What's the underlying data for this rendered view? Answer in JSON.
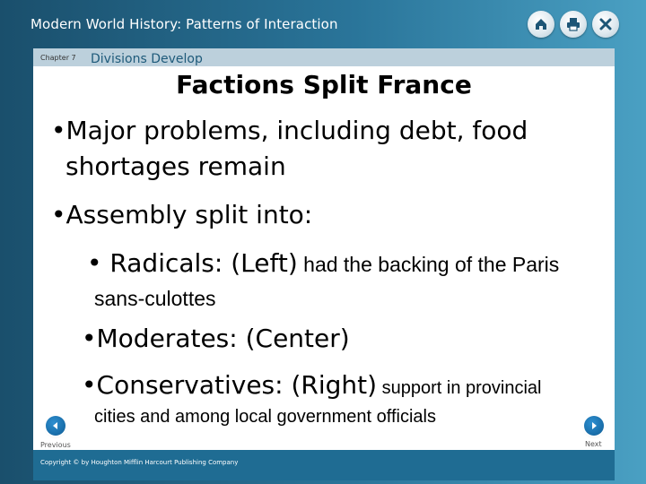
{
  "header": {
    "app_title": "Modern World History: Patterns of Interaction"
  },
  "top_icons": [
    "home-icon",
    "print-icon",
    "close-icon"
  ],
  "chapter": {
    "label": "Chapter 7",
    "title": "Divisions Develop"
  },
  "slide": {
    "heading": "Factions Split France",
    "bullets": [
      {
        "marker": "•",
        "text_line1": "Major problems, including debt, food",
        "text_line2": "shortages remain"
      },
      {
        "marker": "•",
        "text": "Assembly split into:"
      },
      {
        "marker": "•",
        "label": "Radicals: (Left)",
        "detail": " had the backing of the Paris",
        "detail_line2": "sans-culottes"
      },
      {
        "marker": "•",
        "label": "Moderates: (Center)"
      },
      {
        "marker": "•",
        "label": "Conservatives: (Right)",
        "detail": " support in provincial",
        "detail_line2": "cities and among local government officials"
      }
    ]
  },
  "nav": {
    "previous_label": "Previous",
    "next_label": "Next"
  },
  "footer": {
    "copyright": "Copyright © by Houghton Mifflin Harcourt Publishing Company"
  },
  "colors": {
    "frame": "#1f5e80",
    "chapter_strip": "#bcd0dc",
    "footer_strip": "#1f6c93",
    "nav_button": "#0e5d96"
  }
}
